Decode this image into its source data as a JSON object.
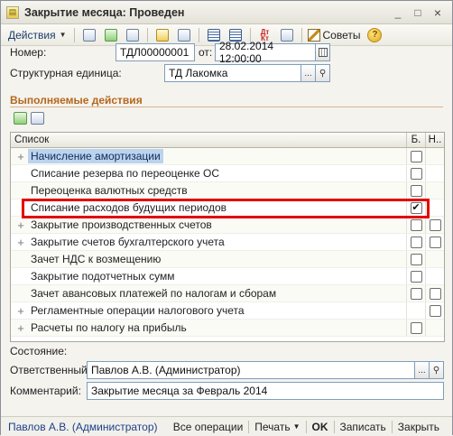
{
  "window": {
    "title": "Закрытие месяца: Проведен",
    "controls": [
      "_",
      "□",
      "×"
    ]
  },
  "toolbar": {
    "actions_label": "Действия",
    "advice_label": "Советы",
    "dtkt_icon_text": "Дт\nКт",
    "help_glyph": "?"
  },
  "form": {
    "number_label": "Номер:",
    "number_value": "ТДЛ00000001",
    "from_label": "от:",
    "date_value": "28.02.2014 12:00:00",
    "unit_label": "Структурная единица:",
    "unit_value": "ТД Лакомка",
    "unit_btn": "...",
    "section_title": "Выполняемые действия",
    "state_label": "Состояние:",
    "responsible_label": "Ответственный:",
    "responsible_value": "Павлов А.В. (Администратор)",
    "comment_label": "Комментарий:",
    "comment_value": "Закрытие месяца за Февраль 2014"
  },
  "table": {
    "headers": [
      "Список",
      "Б.",
      "Н.."
    ],
    "rows": [
      {
        "text": "Начисление амортизации",
        "expander": "+",
        "b": "box",
        "n": ""
      },
      {
        "text": "Списание резерва по переоценке ОС",
        "expander": "",
        "b": "box",
        "n": ""
      },
      {
        "text": "Переоценка валютных средств",
        "expander": "",
        "b": "box",
        "n": ""
      },
      {
        "text": "Списание расходов будущих периодов",
        "expander": "",
        "b": "checked",
        "n": ""
      },
      {
        "text": "Закрытие производственных счетов",
        "expander": "+",
        "b": "box",
        "n": "box"
      },
      {
        "text": "Закрытие счетов бухгалтерского учета",
        "expander": "+",
        "b": "box",
        "n": "box"
      },
      {
        "text": "Зачет НДС к возмещению",
        "expander": "",
        "b": "box",
        "n": ""
      },
      {
        "text": "Закрытие подотчетных сумм",
        "expander": "",
        "b": "box",
        "n": ""
      },
      {
        "text": "Зачет авансовых платежей по налогам и сборам",
        "expander": "",
        "b": "box",
        "n": "box"
      },
      {
        "text": "Регламентные операции налогового учета",
        "expander": "+",
        "b": "",
        "n": "box"
      },
      {
        "text": "Расчеты по налогу на прибыль",
        "expander": "+",
        "b": "box",
        "n": ""
      }
    ]
  },
  "statusbar": {
    "user": "Павлов А.В. (Администратор)",
    "all_ops": "Все операции",
    "print": "Печать",
    "ok": "OK",
    "save": "Записать",
    "close": "Закрыть"
  },
  "colors": {
    "section_title": "#b5671c",
    "highlight_border": "#e30000",
    "selection": "#bcd3ee",
    "link_blue": "#1f3f8a"
  }
}
